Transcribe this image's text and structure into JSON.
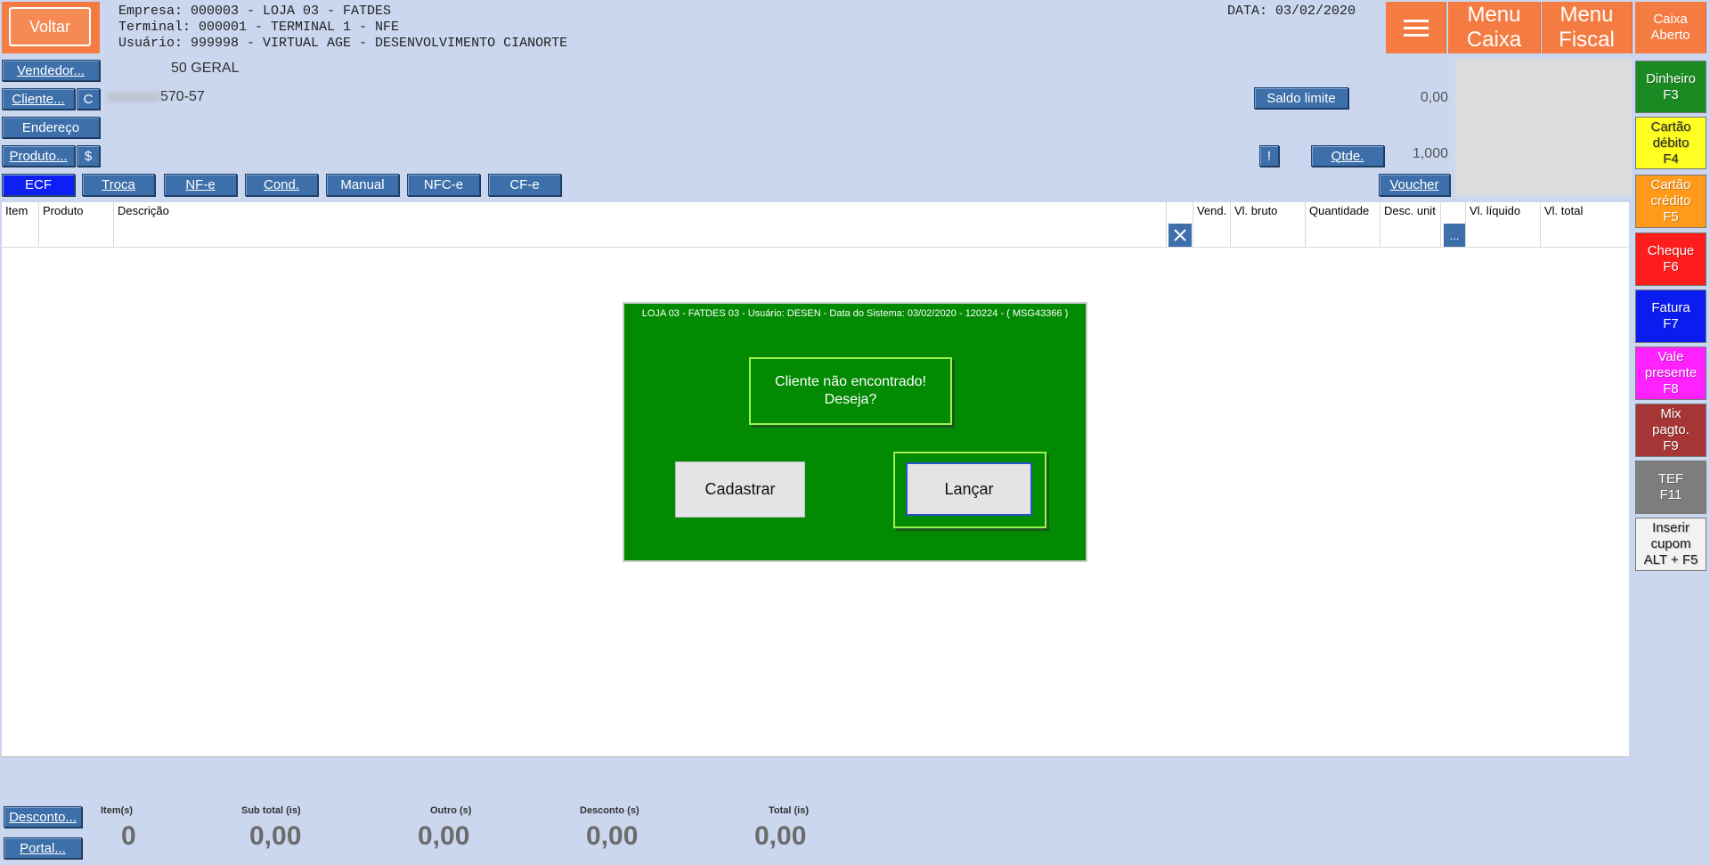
{
  "header": {
    "back_label": "Voltar",
    "empresa": "Empresa: 000003 - LOJA 03 - FATDES",
    "terminal": "Terminal: 000001 - TERMINAL 1 - NFE",
    "usuario": "Usuário: 999998 - VIRTUAL AGE - DESENVOLVIMENTO CIANORTE",
    "data": "DATA: 03/02/2020",
    "menu_caixa": "Menu Caixa",
    "menu_fiscal": "Menu Fiscal",
    "caixa_status": "Caixa Aberto"
  },
  "form": {
    "vendedor_label": "Vendedor...",
    "vendedor_value": "50 GERAL",
    "cliente_label": "Cliente...",
    "cliente_c_label": "C",
    "cliente_value": "570-57",
    "endereco_label": "Endereço",
    "produto_label": "Produto...",
    "produto_dollar_label": "$",
    "saldo_limite_label": "Saldo limite",
    "saldo_value": "0,00",
    "info_label": "!",
    "qtde_label": "Qtde.",
    "qtde_value": "1,000",
    "voucher_label": "Voucher"
  },
  "modes": [
    "ECF",
    "Troca",
    "NF-e",
    "Cond.",
    "Manual",
    "NFC-e",
    "CF-e"
  ],
  "table": {
    "columns": [
      "Item",
      "Produto",
      "Descrição",
      "Vend.",
      "Vl. bruto",
      "Quantidade",
      "Desc. unit",
      "Vl. líquido",
      "Vl. total"
    ],
    "clear_icon": "close-icon",
    "more_label": "..."
  },
  "dialog": {
    "title": "LOJA 03 - FATDES 03 - Usuário: DESEN - Data do Sistema: 03/02/2020 - 120224 - ( MSG43366 )",
    "message_line1": "Cliente não encontrado!",
    "message_line2": "Deseja?",
    "cadastrar_label": "Cadastrar",
    "lancar_label": "Lançar"
  },
  "payments": [
    {
      "label": "Dinheiro\nF3",
      "bg": "#1c8a22",
      "fg": "#ffffff"
    },
    {
      "label": "Cartão\ndébito\nF4",
      "bg": "#ffff22",
      "fg": "#2a2a2a"
    },
    {
      "label": "Cartão\ncrédito\nF5",
      "bg": "#ff9a1a",
      "fg": "#ffffff"
    },
    {
      "label": "Cheque\nF6",
      "bg": "#ff1c1c",
      "fg": "#ffffff"
    },
    {
      "label": "Fatura\nF7",
      "bg": "#0a1cf0",
      "fg": "#ffffff"
    },
    {
      "label": "Vale\npresente\nF8",
      "bg": "#ff22ff",
      "fg": "#ffffff"
    },
    {
      "label": "Mix\npagto.\nF9",
      "bg": "#a63535",
      "fg": "#ffffff"
    },
    {
      "label": "TEF\nF11",
      "bg": "#7d7d7d",
      "fg": "#ffffff"
    },
    {
      "label": "Inserir\ncupom\nALT + F5",
      "bg": "#f2f2f2",
      "fg": "#222222"
    }
  ],
  "footer": {
    "desconto_label": "Desconto...",
    "portal_label": "Portal...",
    "itens_label": "Item(s)",
    "itens_value": "0",
    "subtotal_label": "Sub total (is)",
    "subtotal_value": "0,00",
    "outro_label": "Outro (s)",
    "outro_value": "0,00",
    "desconto_total_label": "Desconto (s)",
    "desconto_total_value": "0,00",
    "total_label": "Total (is)",
    "total_value": "0,00"
  }
}
